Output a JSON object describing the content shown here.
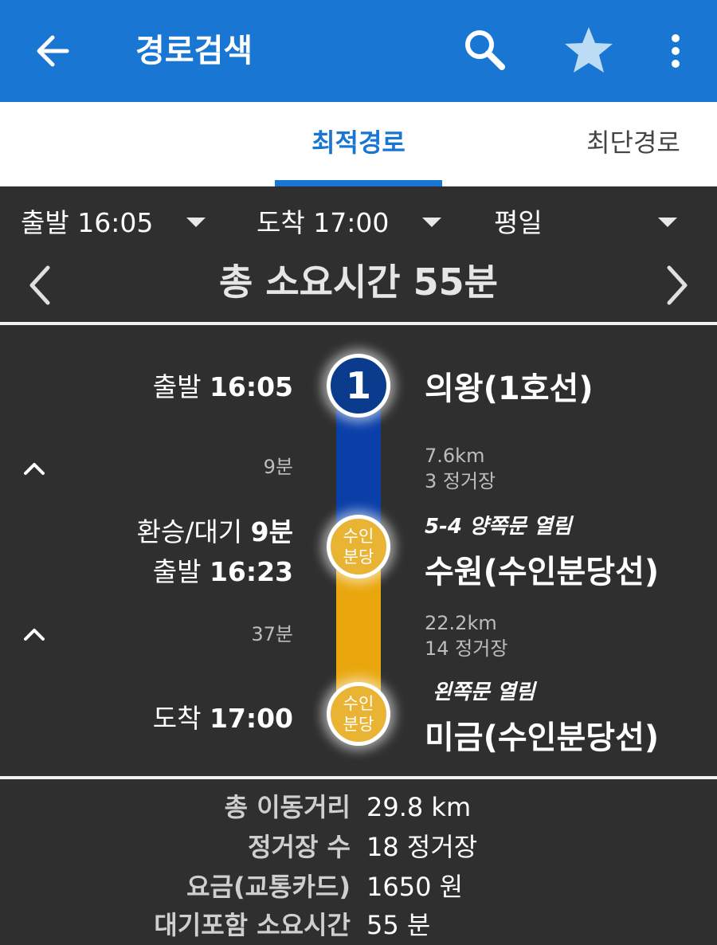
{
  "appbar": {
    "title": "경로검색",
    "icons": [
      "back-arrow-icon",
      "search-icon",
      "star-icon",
      "more-vert-icon"
    ],
    "color": "#1976d2"
  },
  "tabs": [
    {
      "label": "최적경로",
      "active": true
    },
    {
      "label": "최단경로",
      "active": false
    }
  ],
  "header": {
    "departure": "출발 16:05",
    "arrival": "도착 17:00",
    "day_type": "평일",
    "total_time": "총 소요시간 55분"
  },
  "route": {
    "stops": [
      {
        "label": "출발",
        "time": "16:05",
        "badge": "1",
        "name": "의왕(1호선)",
        "line_color": "#0a3b8c"
      },
      {
        "wait_label": "환승/대기",
        "wait": "9분",
        "label": "출발",
        "time": "16:23",
        "badge": "수인\n분당",
        "door": "5-4  양쪽문 열림",
        "name": "수원(수인분당선)",
        "line_color": "#e9b334"
      },
      {
        "label": "도착",
        "time": "17:00",
        "badge": "수인\n분당",
        "door": "왼쪽문 열림",
        "name": "미금(수인분당선)"
      }
    ],
    "segments": [
      {
        "duration": "9분",
        "distance": "7.6km",
        "stations": "3 정거장",
        "color": "#0a3fa8"
      },
      {
        "duration": "37분",
        "distance": "22.2km",
        "stations": "14 정거장",
        "color": "#e9a70d"
      }
    ]
  },
  "summary": [
    {
      "key": "총 이동거리",
      "value": "29.8 km"
    },
    {
      "key": "정거장 수",
      "value": "18 정거장"
    },
    {
      "key": "요금(교통카드)",
      "value": "1650 원"
    },
    {
      "key": "대기포함 소요시간",
      "value": "55 분"
    }
  ]
}
